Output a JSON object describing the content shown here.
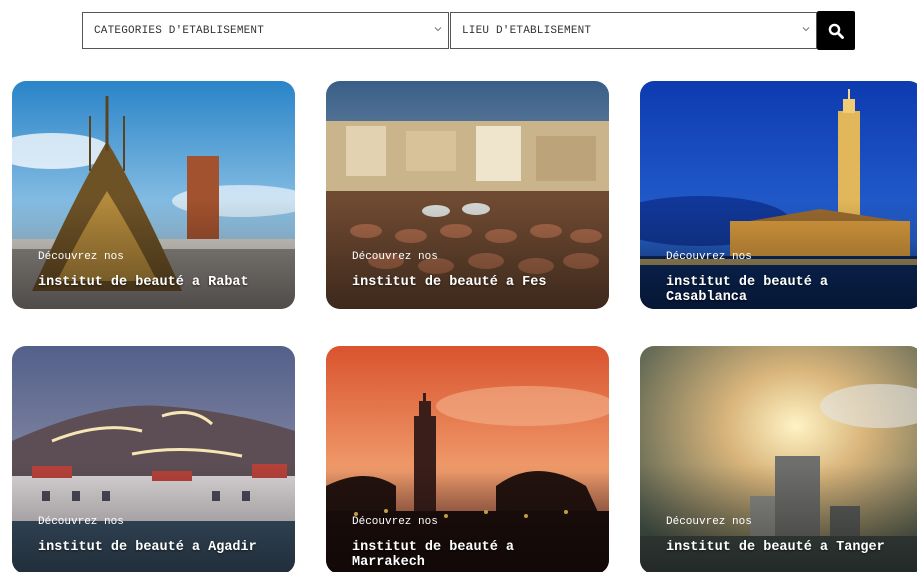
{
  "search": {
    "categories_label": "CATEGORIES D'ETABLISEMENT",
    "location_label": "LIEU D'ETABLISEMENT",
    "search_icon": "search-icon",
    "chevron_icon": "chevron-down-icon"
  },
  "cards": [
    {
      "intro": "Découvrez nos",
      "title": "institut de beauté a Rabat"
    },
    {
      "intro": "Découvrez nos",
      "title": "institut de beauté a Fes"
    },
    {
      "intro": "Découvrez nos",
      "title": "institut de beauté a Casablanca"
    },
    {
      "intro": "Découvrez nos",
      "title": "institut de beauté a Agadir"
    },
    {
      "intro": "Découvrez nos",
      "title": "institut de beauté a Marrakech"
    },
    {
      "intro": "Découvrez nos",
      "title": "institut de beauté a Tanger"
    }
  ]
}
